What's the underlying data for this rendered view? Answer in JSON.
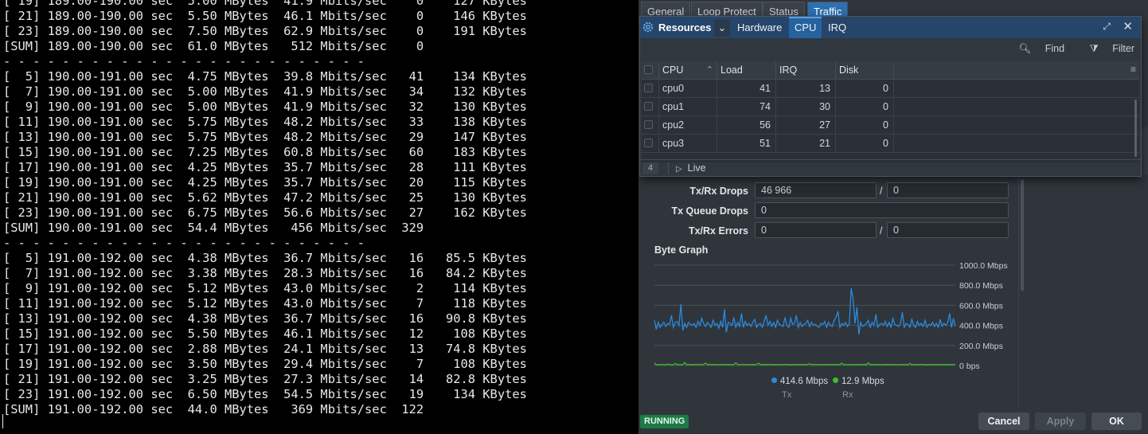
{
  "terminal": {
    "lines": [
      "[ 19] 189.00-190.00 sec  5.00 MBytes  41.9 Mbits/sec    0    127 KBytes",
      "[ 21] 189.00-190.00 sec  5.50 MBytes  46.1 Mbits/sec    0    146 KBytes",
      "[ 23] 189.00-190.00 sec  7.50 MBytes  62.9 Mbits/sec    0    191 KBytes",
      "[SUM] 189.00-190.00 sec  61.0 MBytes   512 Mbits/sec    0",
      "- - - - - - - - - - - - - - - - - - - - - - - - -",
      "[  5] 190.00-191.00 sec  4.75 MBytes  39.8 Mbits/sec   41    134 KBytes",
      "[  7] 190.00-191.00 sec  5.00 MBytes  41.9 Mbits/sec   34    132 KBytes",
      "[  9] 190.00-191.00 sec  5.00 MBytes  41.9 Mbits/sec   32    130 KBytes",
      "[ 11] 190.00-191.00 sec  5.75 MBytes  48.2 Mbits/sec   33    138 KBytes",
      "[ 13] 190.00-191.00 sec  5.75 MBytes  48.2 Mbits/sec   29    147 KBytes",
      "[ 15] 190.00-191.00 sec  7.25 MBytes  60.8 Mbits/sec   60    183 KBytes",
      "[ 17] 190.00-191.00 sec  4.25 MBytes  35.7 Mbits/sec   28    111 KBytes",
      "[ 19] 190.00-191.00 sec  4.25 MBytes  35.7 Mbits/sec   20    115 KBytes",
      "[ 21] 190.00-191.00 sec  5.62 MBytes  47.2 Mbits/sec   25    130 KBytes",
      "[ 23] 190.00-191.00 sec  6.75 MBytes  56.6 Mbits/sec   27    162 KBytes",
      "[SUM] 190.00-191.00 sec  54.4 MBytes   456 Mbits/sec  329",
      "- - - - - - - - - - - - - - - - - - - - - - - - -",
      "[  5] 191.00-192.00 sec  4.38 MBytes  36.7 Mbits/sec   16   85.5 KBytes",
      "[  7] 191.00-192.00 sec  3.38 MBytes  28.3 Mbits/sec   16   84.2 KBytes",
      "[  9] 191.00-192.00 sec  5.12 MBytes  43.0 Mbits/sec    2    114 KBytes",
      "[ 11] 191.00-192.00 sec  5.12 MBytes  43.0 Mbits/sec    7    118 KBytes",
      "[ 13] 191.00-192.00 sec  4.38 MBytes  36.7 Mbits/sec   16   90.8 KBytes",
      "[ 15] 191.00-192.00 sec  5.50 MBytes  46.1 Mbits/sec   12    108 KBytes",
      "[ 17] 191.00-192.00 sec  2.88 MBytes  24.1 Mbits/sec   13   74.8 KBytes",
      "[ 19] 191.00-192.00 sec  3.50 MBytes  29.4 Mbits/sec    7    108 KBytes",
      "[ 21] 191.00-192.00 sec  3.25 MBytes  27.3 Mbits/sec   14   82.8 KBytes",
      "[ 23] 191.00-192.00 sec  6.50 MBytes  54.5 Mbits/sec   19    134 KBytes",
      "[SUM] 191.00-192.00 sec  44.0 MBytes   369 Mbits/sec  122"
    ]
  },
  "app": {
    "tabs": [
      "General",
      "Loop Protect",
      "Status",
      "Traffic"
    ],
    "active_tab": "Traffic",
    "fields": {
      "txrx_drops_label": "Tx/Rx Drops",
      "txrx_drops_tx": "46 966",
      "txrx_drops_rx": "0",
      "txq_drops_label": "Tx Queue Drops",
      "txq_drops": "0",
      "txrx_errors_label": "Tx/Rx Errors",
      "txrx_errors_tx": "0",
      "txrx_errors_rx": "0",
      "slash": "/"
    },
    "graph": {
      "title": "Byte Graph",
      "y_tick_labels": [
        "1000.0 Mbps",
        "800.0 Mbps",
        "600.0 Mbps",
        "400.0 Mbps",
        "200.0 Mbps",
        "0 bps"
      ],
      "ylim": [
        0,
        1000
      ],
      "tx_color": "#2a8ae0",
      "rx_color": "#3cbf2a",
      "legend": [
        {
          "value": "414.6 Mbps",
          "name": "Tx",
          "color": "#2a8ae0"
        },
        {
          "value": "12.9 Mbps",
          "name": "Rx",
          "color": "#3cbf2a"
        }
      ]
    },
    "status": "RUNNING",
    "buttons": {
      "cancel": "Cancel",
      "apply": "Apply",
      "ok": "OK"
    }
  },
  "resources": {
    "title": "Resources",
    "tabs": [
      "Hardware",
      "CPU",
      "IRQ"
    ],
    "active_tab": "CPU",
    "toolbar": {
      "find": "Find",
      "filter": "Filter"
    },
    "columns": [
      "CPU",
      "Load",
      "IRQ",
      "Disk"
    ],
    "rows": [
      {
        "cpu": "cpu0",
        "load": "41",
        "irq": "13",
        "disk": "0"
      },
      {
        "cpu": "cpu1",
        "load": "74",
        "irq": "30",
        "disk": "0"
      },
      {
        "cpu": "cpu2",
        "load": "56",
        "irq": "27",
        "disk": "0"
      },
      {
        "cpu": "cpu3",
        "load": "51",
        "irq": "21",
        "disk": "0"
      }
    ],
    "row_count": "4",
    "live_label": "Live"
  },
  "chart_data": {
    "type": "line",
    "title": "Byte Graph",
    "ylabel": "",
    "ylim": [
      0,
      1000
    ],
    "y_ticks": [
      "1000.0 Mbps",
      "800.0 Mbps",
      "600.0 Mbps",
      "400.0 Mbps",
      "200.0 Mbps",
      "0 bps"
    ],
    "series": [
      {
        "name": "Tx",
        "color": "#2a8ae0",
        "values": [
          450,
          360,
          430,
          380,
          410,
          430,
          390,
          420,
          410,
          500,
          380,
          430,
          440,
          400,
          610,
          350,
          420,
          380,
          430,
          410,
          400,
          420,
          380,
          440,
          400,
          470,
          420,
          390,
          430,
          410,
          380,
          450,
          400,
          420,
          370,
          440,
          380,
          560,
          330,
          430,
          420,
          400,
          480,
          380,
          430,
          390,
          520,
          380,
          440,
          400,
          420,
          390,
          430,
          460,
          380,
          410,
          420,
          380,
          440,
          500,
          400,
          440,
          390,
          430,
          380,
          450,
          410,
          400,
          390,
          480,
          400,
          380,
          470,
          410,
          420,
          500,
          380,
          430,
          390,
          410,
          420,
          450,
          390,
          430,
          400,
          410,
          390,
          380,
          420,
          410,
          440,
          380,
          430,
          400,
          390,
          450,
          480,
          540,
          380,
          420,
          400,
          430,
          390,
          420,
          770,
          660,
          420,
          580,
          310,
          430,
          390,
          400,
          420,
          450,
          380,
          430,
          400,
          510,
          380,
          410,
          420,
          400,
          440,
          390,
          430,
          380,
          470,
          410,
          400,
          390,
          420,
          530,
          380,
          420,
          410,
          380,
          460,
          400,
          380,
          440,
          400,
          420,
          390,
          450,
          380,
          410,
          400,
          430,
          390,
          420,
          380,
          460,
          390,
          420,
          400,
          430,
          520,
          380,
          470,
          390
        ]
      },
      {
        "name": "Rx",
        "color": "#3cbf2a",
        "values": [
          25,
          5,
          10,
          8,
          12,
          6,
          9,
          14,
          7,
          10,
          8,
          20,
          9,
          11,
          7,
          10,
          30,
          8,
          12,
          9,
          10,
          7,
          13,
          9,
          11,
          8,
          10,
          25,
          9,
          12,
          8,
          10,
          9,
          11,
          7,
          10,
          8,
          12,
          9,
          10,
          7,
          11,
          9,
          28,
          10,
          8,
          12,
          9,
          10,
          7,
          11,
          9,
          10,
          8,
          12,
          22,
          9,
          11,
          8,
          10,
          9,
          12,
          8,
          10,
          9,
          11,
          7,
          10,
          8,
          12,
          9,
          10,
          7,
          11,
          9,
          10,
          8,
          12,
          9,
          10,
          7,
          11,
          18,
          10,
          8,
          12,
          9,
          10,
          7,
          11,
          9,
          10,
          8,
          12,
          9,
          10,
          7,
          11,
          9,
          24,
          8,
          12,
          9,
          10,
          7,
          11,
          9,
          10,
          8,
          12,
          9,
          10,
          7,
          26,
          9,
          10,
          8,
          12,
          9,
          10,
          7,
          11,
          9,
          10,
          8,
          12,
          9,
          10,
          7,
          11,
          9,
          10,
          8,
          12,
          9,
          20,
          7,
          11,
          9,
          10,
          8,
          12,
          9,
          10,
          7,
          11,
          9,
          10,
          8,
          12,
          9,
          10,
          7,
          11,
          9,
          10,
          8,
          12,
          9,
          10
        ]
      }
    ]
  }
}
